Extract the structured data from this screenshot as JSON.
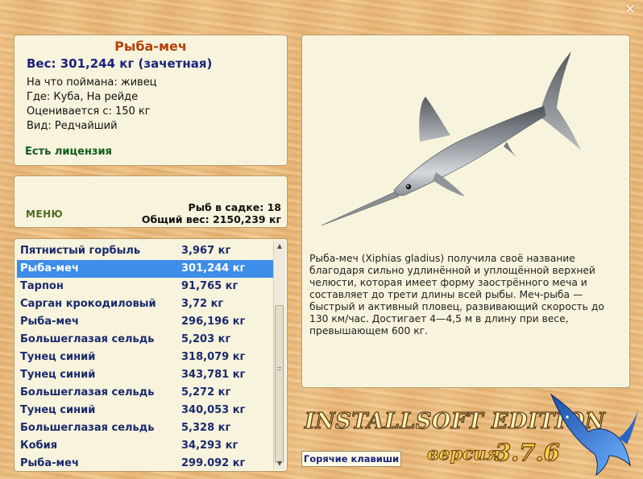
{
  "window": {
    "close_glyph": "✕"
  },
  "info": {
    "title": "Рыба-меч",
    "weight": "Вес: 301,244 кг (зачетная)",
    "bait": "На что поймана: живец",
    "location": "Где: Куба, На рейде",
    "rated_from": "Оценивается с: 150 кг",
    "kind": "Вид: Редчайший",
    "license": "Есть лицензия"
  },
  "menu": {
    "label": "МЕНЮ",
    "fish_in_cage": "Рыб в садке: 18",
    "total_weight": "Общий вес: 2150,239 кг"
  },
  "catch_list": {
    "selected_index": 1,
    "rows": [
      {
        "name": "Пятнистый горбыль",
        "weight": "3,967 кг"
      },
      {
        "name": "Рыба-меч",
        "weight": "301,244 кг"
      },
      {
        "name": "Тарпон",
        "weight": "91,765 кг"
      },
      {
        "name": "Сарган крокодиловый",
        "weight": "3,72 кг"
      },
      {
        "name": "Рыба-меч",
        "weight": "296,196 кг"
      },
      {
        "name": "Большеглазая сельдь",
        "weight": "5,203 кг"
      },
      {
        "name": "Тунец синий",
        "weight": "318,079 кг"
      },
      {
        "name": "Тунец синий",
        "weight": "343,781 кг"
      },
      {
        "name": "Большеглазая сельдь",
        "weight": "5,272 кг"
      },
      {
        "name": "Тунец синий",
        "weight": "340,053 кг"
      },
      {
        "name": "Большеглазая сельдь",
        "weight": "5,328 кг"
      },
      {
        "name": "Кобия",
        "weight": "34,293 кг"
      },
      {
        "name": "Рыба-меч",
        "weight": "299.092 кг"
      }
    ]
  },
  "description": {
    "text": "Рыба-меч (Xiphias gladius) получила своё название благодаря сильно удлинённой и уплощённой верхней челюсти, которая имеет форму заострённого меча и составляет до трети длины всей рыбы. Меч-рыба — быстрый и активный пловец, развивающий скорость до 130 км/час. Достигает 4—4,5 м в длину при весе, превышающем 600 кг."
  },
  "hotkeys_label": "Горячие клавиши",
  "branding": {
    "logo": "INSTALLSOFT EDITION",
    "version_label": "версия",
    "version_number": "3.7.6"
  },
  "colors": {
    "selection": "#3d8ee8",
    "title": "#b4410b",
    "weight_text": "#1a237e",
    "license": "#0e5c1c"
  }
}
